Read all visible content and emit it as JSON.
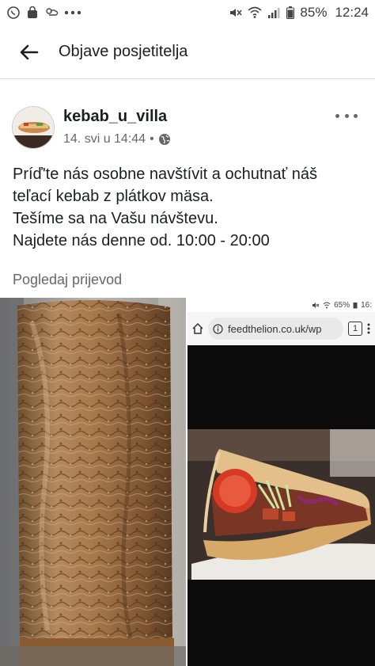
{
  "status_bar": {
    "icons_left": [
      "whatsapp-icon",
      "shopping-bag-icon",
      "weather-icon",
      "more-notifications-icon"
    ],
    "icons_right": [
      "mute-icon",
      "wifi-icon",
      "signal-icon"
    ],
    "battery": "85%",
    "time": "12:24"
  },
  "app_bar": {
    "back_icon": "arrow-left-icon",
    "title": "Objave posjetitelja"
  },
  "post": {
    "author": "kebab_u_villa",
    "timestamp": "14. svi u 14:44",
    "separator": "•",
    "audience_icon": "globe-icon",
    "more_icon": "more-horizontal-icon",
    "text_lines": [
      "Príď'te nás osobne navštívit a ochutnať náš",
      "teľací kebab z plátkov mäsa.",
      "Tešíme sa na Vašu návštevu.",
      "Najdete nás denne od. 10:00 - 20:00"
    ],
    "translate_label": "Pogledaj prijevod"
  },
  "embedded_screenshot": {
    "status_text": "65%",
    "time": "16:",
    "url": "feedthelion.co.uk/wp",
    "tab_count": "1"
  },
  "colors": {
    "text": "#1c1e21",
    "secondary": "#65676b",
    "divider": "#d6d6d6"
  }
}
